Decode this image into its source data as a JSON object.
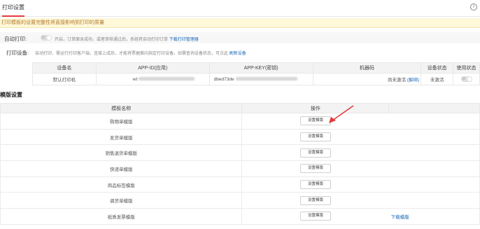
{
  "tabs": {
    "active": "打印设置"
  },
  "help_icon": "help-icon",
  "notice": "打印模板的设置完整性将直接影响到打印的质量",
  "auto_print": {
    "label": "自动打印:",
    "toggle_text": "O",
    "hint_text": "开启，订单面含成功、或者审核通过后，系统将自动打印订单",
    "link": "下载打印管理器"
  },
  "print_device": {
    "label": "打印设备:",
    "hint_text": "自动打印、需运行打印客户端，连接上成后，才能将票据推向指定打印设备。如需查询设备状态，可点此",
    "link": "刷新设备"
  },
  "device_table": {
    "headers": [
      "设备名",
      "APP-ID(应用)",
      "APP-KEY(密钥)",
      "机器码",
      "设备状态",
      "使用状态"
    ],
    "row": {
      "name": "默认打印机",
      "app_id": "wt",
      "app_key": "dbed73de",
      "machine_code": "尚未激活",
      "machine_link": "(解绑)",
      "status": "未激活",
      "toggle_text": "O"
    }
  },
  "section_title": "模版设置",
  "template_table": {
    "headers": [
      "模板名称",
      "操作"
    ],
    "rows": [
      {
        "name": "购物单模版",
        "button": "设置模版",
        "extra": ""
      },
      {
        "name": "发货单模版",
        "button": "设置模版",
        "extra": ""
      },
      {
        "name": "销售退货单模版",
        "button": "设置模版",
        "extra": ""
      },
      {
        "name": "快递单模版",
        "button": "设置模版",
        "extra": ""
      },
      {
        "name": "商品标签模版",
        "button": "设置模版",
        "extra": ""
      },
      {
        "name": "调货单模版",
        "button": "设置模版",
        "extra": ""
      },
      {
        "name": "纸质发票模版",
        "button": "设置模版",
        "extra": "下载模版"
      }
    ]
  },
  "colors": {
    "accent": "#e4393c",
    "link": "#1a6ab8",
    "notice_bg": "#fff8d9"
  }
}
